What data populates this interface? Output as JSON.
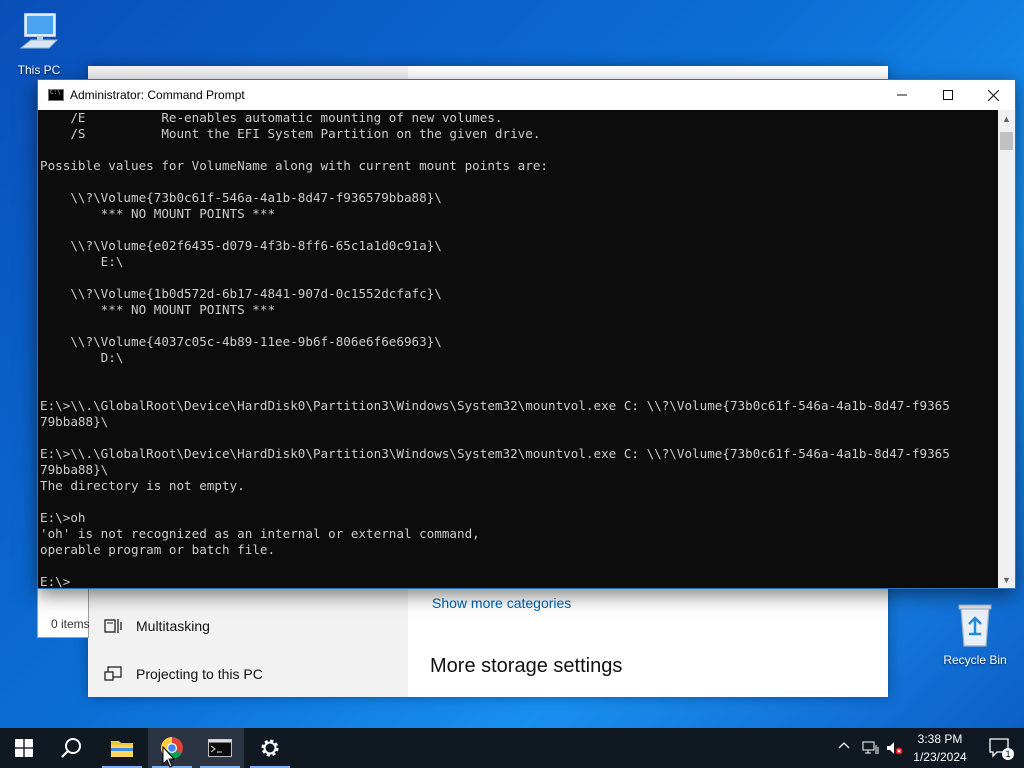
{
  "desktop": {
    "icons": [
      {
        "label": "This PC",
        "icon": "computer-icon"
      },
      {
        "label": "Recycle Bin",
        "icon": "recycle-bin-icon"
      }
    ]
  },
  "explorer": {
    "status": "0 items"
  },
  "settings": {
    "nav_items": [
      {
        "label": "Multitasking",
        "icon": "multitasking-icon"
      },
      {
        "label": "Projecting to this PC",
        "icon": "projecting-icon"
      }
    ],
    "show_more_link": "Show more categories",
    "section_heading": "More storage settings"
  },
  "cmd": {
    "title": "Administrator: Command Prompt",
    "lines": [
      "    /E          Re-enables automatic mounting of new volumes.",
      "    /S          Mount the EFI System Partition on the given drive.",
      "",
      "Possible values for VolumeName along with current mount points are:",
      "",
      "    \\\\?\\Volume{73b0c61f-546a-4a1b-8d47-f936579bba88}\\",
      "        *** NO MOUNT POINTS ***",
      "",
      "    \\\\?\\Volume{e02f6435-d079-4f3b-8ff6-65c1a1d0c91a}\\",
      "        E:\\",
      "",
      "    \\\\?\\Volume{1b0d572d-6b17-4841-907d-0c1552dcfafc}\\",
      "        *** NO MOUNT POINTS ***",
      "",
      "    \\\\?\\Volume{4037c05c-4b89-11ee-9b6f-806e6f6e6963}\\",
      "        D:\\",
      "",
      "",
      "E:\\>\\\\.\\GlobalRoot\\Device\\HardDisk0\\Partition3\\Windows\\System32\\mountvol.exe C: \\\\?\\Volume{73b0c61f-546a-4a1b-8d47-f9365",
      "79bba88}\\",
      "",
      "E:\\>\\\\.\\GlobalRoot\\Device\\HardDisk0\\Partition3\\Windows\\System32\\mountvol.exe C: \\\\?\\Volume{73b0c61f-546a-4a1b-8d47-f9365",
      "79bba88}\\",
      "The directory is not empty.",
      "",
      "E:\\>oh",
      "'oh' is not recognized as an internal or external command,",
      "operable program or batch file.",
      "",
      "E:\\>"
    ]
  },
  "taskbar": {
    "time": "3:38 PM",
    "date": "1/23/2024",
    "notification_count": "1",
    "pinned": [
      {
        "name": "start-button",
        "icon": "windows-logo-icon"
      },
      {
        "name": "search-button",
        "icon": "search-icon"
      },
      {
        "name": "file-explorer-button",
        "icon": "folder-icon"
      },
      {
        "name": "chrome-button",
        "icon": "chrome-icon"
      },
      {
        "name": "cmd-button",
        "icon": "terminal-icon"
      },
      {
        "name": "settings-button",
        "icon": "gear-icon"
      }
    ]
  },
  "colors": {
    "accent": "#0078d7",
    "console_bg": "#0c0c0c",
    "console_fg": "#cccccc",
    "link": "#0063b1"
  }
}
